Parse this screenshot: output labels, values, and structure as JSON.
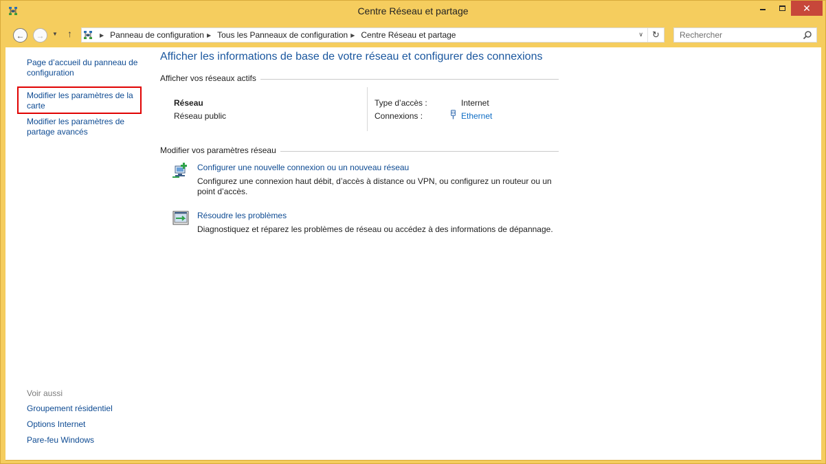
{
  "window": {
    "title": "Centre Réseau et partage",
    "close_glyph": "✕"
  },
  "nav": {
    "back_glyph": "←",
    "forward_glyph": "→",
    "recent_glyph": "▼",
    "up_glyph": "↑"
  },
  "address": {
    "crumbs": [
      "Panneau de configuration",
      "Tous les Panneaux de configuration",
      "Centre Réseau et partage"
    ],
    "separator_glyph": "▶",
    "dropdown_glyph": "∨",
    "refresh_glyph": "↻"
  },
  "search": {
    "placeholder": "Rechercher"
  },
  "sidebar": {
    "items": [
      "Page d’accueil du panneau de configuration",
      "Modifier les paramètres de la carte",
      "Modifier les paramètres de partage avancés"
    ],
    "see_also_label": "Voir aussi",
    "see_also": [
      "Groupement résidentiel",
      "Options Internet",
      "Pare-feu Windows"
    ]
  },
  "main": {
    "heading": "Afficher les informations de base de votre réseau et configurer des connexions",
    "active_networks_label": "Afficher vos réseaux actifs",
    "network": {
      "name": "Réseau",
      "type": "Réseau public",
      "access_label": "Type d’accès :",
      "access_value": "Internet",
      "connections_label": "Connexions :",
      "connections_value": "Ethernet"
    },
    "change_settings_label": "Modifier vos paramètres réseau",
    "tasks": [
      {
        "title": "Configurer une nouvelle connexion ou un nouveau réseau",
        "description": "Configurez une connexion haut débit, d’accès à distance ou VPN, ou configurez un routeur ou un point d’accès."
      },
      {
        "title": "Résoudre les problèmes",
        "description": "Diagnostiquez et réparez les problèmes de réseau ou accédez à des informations de dépannage."
      }
    ]
  },
  "colors": {
    "titlebar": "#f5cd5e",
    "link": "#0d4a92",
    "heading": "#19569e",
    "close_button": "#c7473a",
    "highlight": "#e00000"
  }
}
